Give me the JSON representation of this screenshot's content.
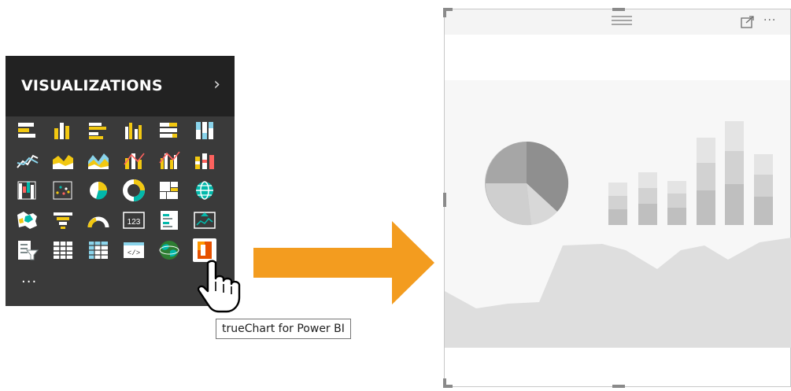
{
  "visualizations_pane": {
    "title": "VISUALIZATIONS",
    "expand_icon": "chevron-right-icon",
    "more_label": "...",
    "icons": [
      {
        "name": "stacked-bar-chart-icon"
      },
      {
        "name": "stacked-column-chart-icon"
      },
      {
        "name": "clustered-bar-chart-icon"
      },
      {
        "name": "clustered-column-chart-icon"
      },
      {
        "name": "100-percent-stacked-bar-chart-icon"
      },
      {
        "name": "100-percent-stacked-column-chart-icon"
      },
      {
        "name": "line-chart-icon"
      },
      {
        "name": "area-chart-icon"
      },
      {
        "name": "stacked-area-chart-icon"
      },
      {
        "name": "line-and-stacked-column-chart-icon"
      },
      {
        "name": "line-and-clustered-column-chart-icon"
      },
      {
        "name": "ribbon-chart-icon"
      },
      {
        "name": "waterfall-chart-icon"
      },
      {
        "name": "scatter-chart-icon"
      },
      {
        "name": "pie-chart-icon"
      },
      {
        "name": "donut-chart-icon"
      },
      {
        "name": "treemap-icon"
      },
      {
        "name": "map-icon"
      },
      {
        "name": "filled-map-icon"
      },
      {
        "name": "funnel-icon"
      },
      {
        "name": "gauge-icon"
      },
      {
        "name": "card-icon"
      },
      {
        "name": "multi-row-card-icon"
      },
      {
        "name": "kpi-icon"
      },
      {
        "name": "slicer-icon"
      },
      {
        "name": "table-icon"
      },
      {
        "name": "matrix-icon"
      },
      {
        "name": "r-script-visual-icon"
      },
      {
        "name": "arcgis-map-icon"
      },
      {
        "name": "truechart-icon",
        "selected": true
      }
    ],
    "card_icon_text": "123"
  },
  "tooltip": {
    "text": "trueChart for Power BI"
  },
  "arrow": {
    "color": "#f39c1f"
  },
  "visual_container": {
    "header_icons": [
      "drag-grip-icon",
      "focus-mode-icon",
      "more-options-icon"
    ],
    "more_label": "···"
  },
  "colors": {
    "accent_orange": "#f39c1f",
    "pane_bg": "#3a3a3a",
    "pane_header": "#222222",
    "icon_yellow": "#f2c811"
  }
}
